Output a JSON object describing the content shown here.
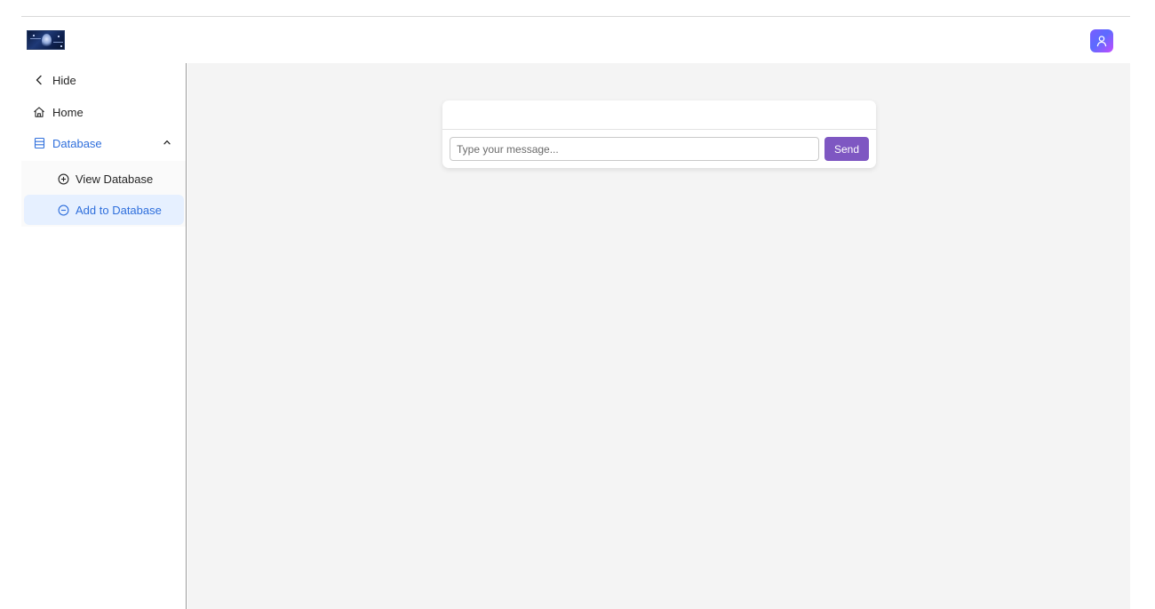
{
  "app": {
    "logo_name": "logo-image",
    "accent_color": "#2f6fdc",
    "send_color": "#7e57c2"
  },
  "header": {
    "user_icon": "user-icon"
  },
  "sidebar": {
    "hide_label": "Hide",
    "items": [
      {
        "label": "Home",
        "icon": "home-icon"
      },
      {
        "label": "Database",
        "icon": "database-icon",
        "expanded": true
      }
    ],
    "sub_items": [
      {
        "label": "View Database",
        "icon": "plus-circle-icon"
      },
      {
        "label": "Add to Database",
        "icon": "minus-circle-icon",
        "selected": true
      }
    ]
  },
  "chat": {
    "input_value": "",
    "input_placeholder": "Type your message...",
    "send_label": "Send"
  }
}
